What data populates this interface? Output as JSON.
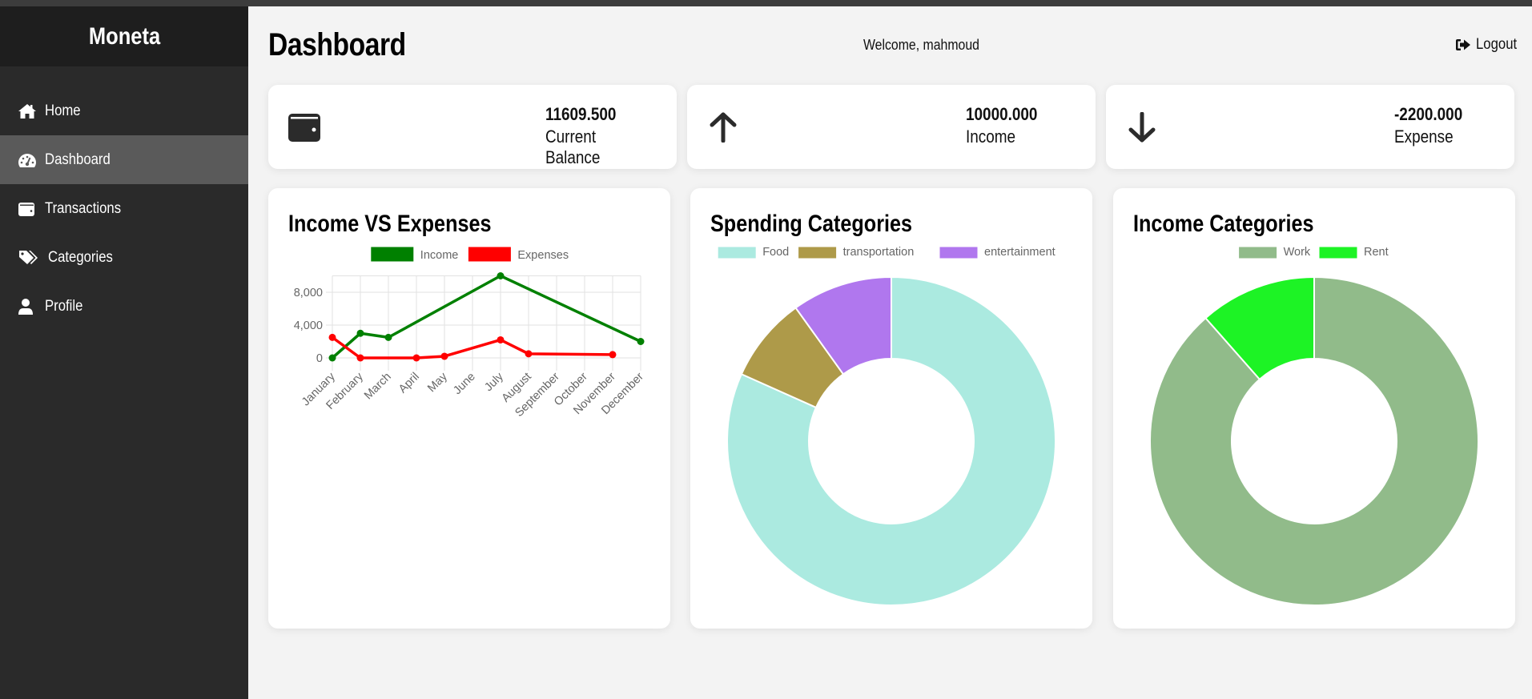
{
  "app": {
    "brand": "Moneta"
  },
  "sidebar": {
    "items": [
      {
        "label": "Home",
        "icon": "home-icon",
        "active": false
      },
      {
        "label": "Dashboard",
        "icon": "gauge-icon",
        "active": true
      },
      {
        "label": "Transactions",
        "icon": "wallet-icon",
        "active": false
      },
      {
        "label": "Categories",
        "icon": "tags-icon",
        "active": false
      },
      {
        "label": "Profile",
        "icon": "user-icon",
        "active": false
      }
    ]
  },
  "header": {
    "title": "Dashboard",
    "welcome": "Welcome, mahmoud",
    "logout_label": "Logout"
  },
  "stats": [
    {
      "value": "11609.500",
      "label": "Current Balance",
      "icon": "wallet-icon"
    },
    {
      "value": "10000.000",
      "label": "Income",
      "icon": "arrow-up-icon"
    },
    {
      "value": "-2200.000",
      "label": "Expense",
      "icon": "arrow-down-icon"
    }
  ],
  "colors": {
    "income": "#008000",
    "expenses": "#ff0000",
    "food": "#abeae0",
    "transportation": "#ae9a49",
    "entertainment": "#b077ee",
    "work": "#91bb8a",
    "rent": "#1df325"
  },
  "chart_data": [
    {
      "type": "line",
      "title": "Income VS Expenses",
      "categories": [
        "January",
        "February",
        "March",
        "April",
        "May",
        "June",
        "July",
        "August",
        "September",
        "October",
        "November",
        "December"
      ],
      "series": [
        {
          "name": "Income",
          "color": "#008000",
          "values": [
            0,
            3000,
            2500,
            null,
            null,
            null,
            10000,
            null,
            null,
            null,
            null,
            2000
          ]
        },
        {
          "name": "Expenses",
          "color": "#ff0000",
          "values": [
            2500,
            0,
            null,
            0,
            200,
            null,
            2200,
            500,
            null,
            null,
            400,
            null
          ]
        }
      ],
      "yticks": [
        0,
        4000,
        8000
      ],
      "ytick_labels": [
        "0",
        "4,000",
        "8,000"
      ],
      "ylim": [
        -1000,
        10000
      ],
      "grid": true,
      "legend": "top-center",
      "xlabel": "",
      "ylabel": ""
    },
    {
      "type": "pie",
      "variant": "doughnut",
      "title": "Spending Categories",
      "categories": [
        "Food",
        "transportation",
        "entertainment"
      ],
      "values_percent": [
        81.7,
        8.4,
        9.9
      ],
      "colors": [
        "#abeae0",
        "#ae9a49",
        "#b077ee"
      ],
      "legend": "top-center"
    },
    {
      "type": "pie",
      "variant": "doughnut",
      "title": "Income Categories",
      "categories": [
        "Work",
        "Rent"
      ],
      "values_percent": [
        88.5,
        11.5
      ],
      "colors": [
        "#91bb8a",
        "#1df325"
      ],
      "legend": "top-center"
    }
  ]
}
